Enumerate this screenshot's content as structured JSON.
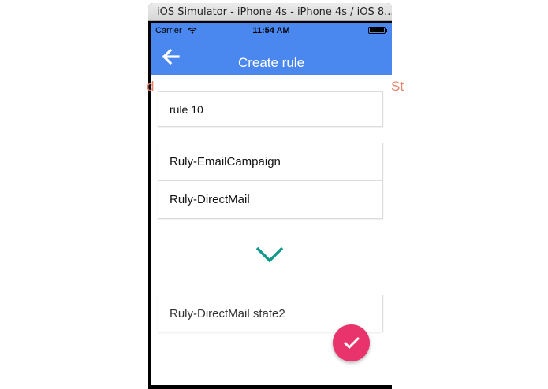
{
  "window": {
    "title": "iOS Simulator - iPhone 4s - iPhone 4s / iOS 8..."
  },
  "status_bar": {
    "carrier": "Carrier",
    "time": "11:54 AM"
  },
  "nav": {
    "title": "Create rule",
    "back_icon": "arrow-left-icon"
  },
  "background_text": {
    "left": "d",
    "right": "St"
  },
  "form": {
    "rule_name": "rule 10",
    "campaign_items": [
      "Ruly-EmailCampaign",
      "Ruly-DirectMail"
    ],
    "target_state": "Ruly-DirectMail state2"
  },
  "icons": {
    "chevron": "chevron-down-icon",
    "fab": "check-icon"
  },
  "colors": {
    "primary": "#4a87ee",
    "accent": "#e8336c",
    "chevron": "#13998a"
  }
}
